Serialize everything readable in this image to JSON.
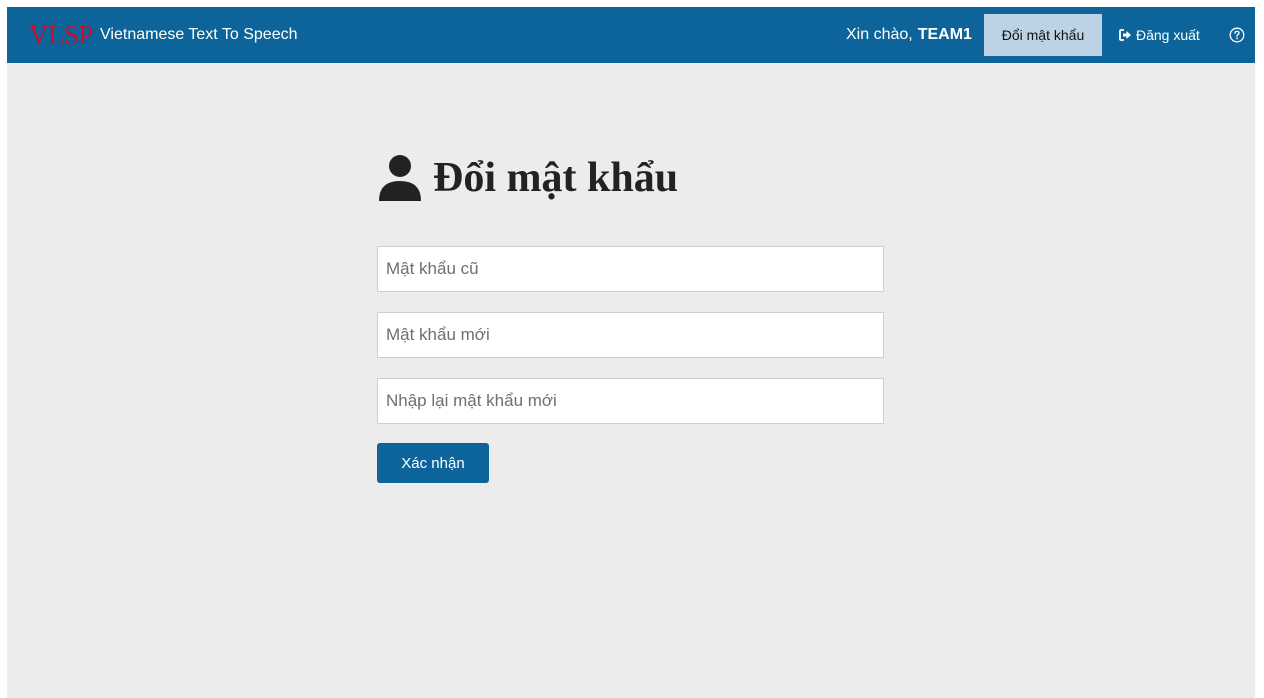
{
  "navbar": {
    "logo_text": "VLSP",
    "app_title": "Vietnamese Text To Speech",
    "greeting_prefix": "Xin chào,",
    "username": "TEAM1",
    "change_password_label": "Đổi mật khẩu",
    "logout_label": "Đăng xuất",
    "logout_icon": "sign-out-icon",
    "help_icon": "question-circle-icon"
  },
  "form": {
    "title": "Đổi mật khẩu",
    "title_icon": "user-icon",
    "old_password_placeholder": "Mật khẩu cũ",
    "new_password_placeholder": "Mật khẩu mới",
    "confirm_password_placeholder": "Nhập lại mật khẩu mới",
    "submit_label": "Xác nhận"
  },
  "colors": {
    "navbar_bg": "#0d649b",
    "active_nav_bg": "#bcd3e6",
    "logo": "#c6102e",
    "page_bg": "#ececec",
    "button_bg": "#0d649b"
  }
}
